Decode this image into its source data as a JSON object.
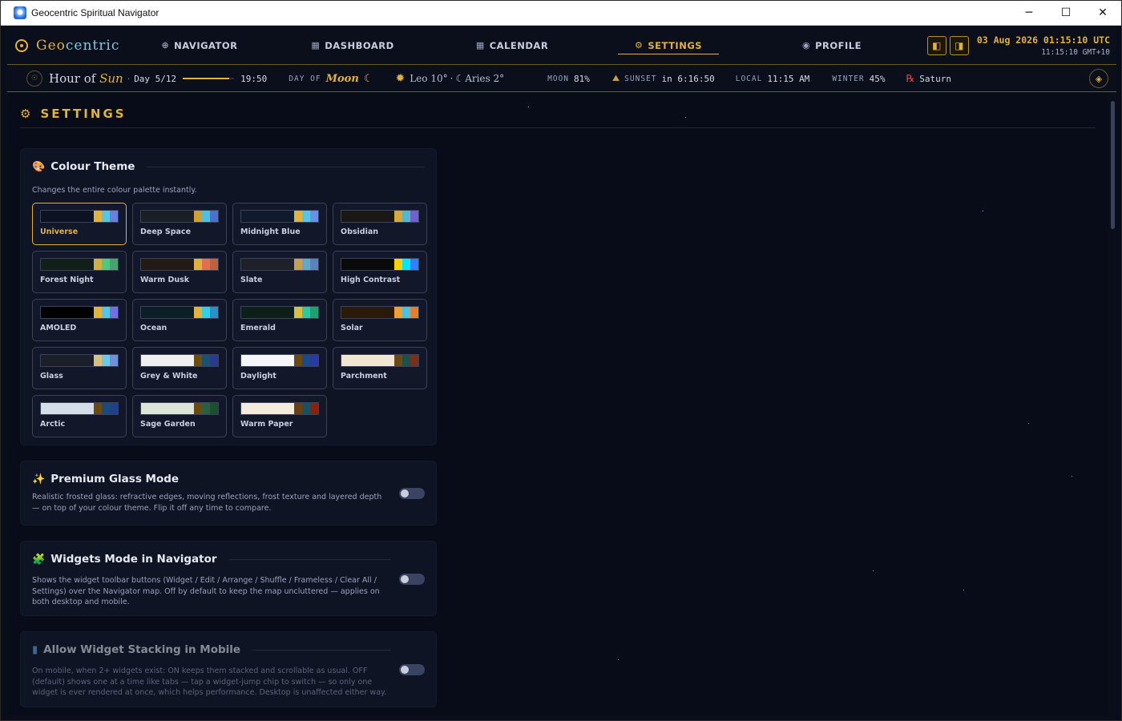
{
  "window": {
    "title": "Geocentric Spiritual Navigator",
    "minimize": "─",
    "maximize": "☐",
    "close": "✕"
  },
  "brand": {
    "prefix": "Geo",
    "suffix": "centric"
  },
  "nav": [
    {
      "icon": "globe-icon",
      "glyph": "⊕",
      "label": "NAVIGATOR"
    },
    {
      "icon": "grid-icon",
      "glyph": "▦",
      "label": "DASHBOARD"
    },
    {
      "icon": "calendar-icon",
      "glyph": "▦",
      "label": "CALENDAR"
    },
    {
      "icon": "gear-icon",
      "glyph": "⚙",
      "label": "SETTINGS",
      "active": true
    },
    {
      "icon": "profile-icon",
      "glyph": "◉",
      "label": "PROFILE"
    }
  ],
  "clock": {
    "utc": "03 Aug 2026 01:15:10 UTC",
    "local": "11:15:10 GMT+10"
  },
  "infobar": {
    "hour_of": "Hour of",
    "hour_planet": "Sun",
    "day": "Day 5/12",
    "day_progress": 0.9,
    "time": "19:50",
    "day_of_label": "DAY OF",
    "day_of_planet": "Moon",
    "sun_sign": "Leo 10°",
    "moon_sign": "Aries 2°",
    "moon_label": "MOON",
    "moon_value": "81%",
    "sunset_label": "SUNSET",
    "sunset_value": "in 6:16:50",
    "local_label": "LOCAL",
    "local_value": "11:15 AM",
    "season_label": "WINTER",
    "season_value": "45%",
    "retro_symbol": "℞",
    "retro_planet": "Saturn"
  },
  "settings": {
    "title": "SETTINGS",
    "colour_theme": {
      "heading": "Colour Theme",
      "description": "Changes the entire colour palette instantly.",
      "themes": [
        {
          "name": "Universe",
          "bg": "#0d1222",
          "colors": [
            "#e3b23c",
            "#56c6e8",
            "#6a80e0"
          ],
          "active": true
        },
        {
          "name": "Deep Space",
          "bg": "#1a1f26",
          "colors": [
            "#d0a030",
            "#50c0e0",
            "#4a70d0"
          ]
        },
        {
          "name": "Midnight Blue",
          "bg": "#101a2e",
          "colors": [
            "#e3b23c",
            "#56c6e8",
            "#6a90e8"
          ]
        },
        {
          "name": "Obsidian",
          "bg": "#1a1814",
          "colors": [
            "#d8a838",
            "#50b8d0",
            "#7060d0"
          ]
        },
        {
          "name": "Forest Night",
          "bg": "#121e18",
          "colors": [
            "#d0b040",
            "#50c880",
            "#4aa070"
          ]
        },
        {
          "name": "Warm Dusk",
          "bg": "#221a14",
          "colors": [
            "#e0b040",
            "#e07050",
            "#c06040"
          ]
        },
        {
          "name": "Slate",
          "bg": "#1e2228",
          "colors": [
            "#c8a050",
            "#60a8d0",
            "#6080b8"
          ]
        },
        {
          "name": "High Contrast",
          "bg": "#0a0a0a",
          "colors": [
            "#ffd000",
            "#00e8ff",
            "#3080ff"
          ]
        },
        {
          "name": "AMOLED",
          "bg": "#000000",
          "colors": [
            "#e3b23c",
            "#56c6e8",
            "#7070e0"
          ]
        },
        {
          "name": "Ocean",
          "bg": "#0e1e26",
          "colors": [
            "#e3b23c",
            "#30d0e8",
            "#2a90c8"
          ]
        },
        {
          "name": "Emerald",
          "bg": "#0e1e18",
          "colors": [
            "#d8c040",
            "#30c8a0",
            "#20a070"
          ]
        },
        {
          "name": "Solar",
          "bg": "#2a1a0a",
          "colors": [
            "#f0a030",
            "#50c0e0",
            "#e08030"
          ]
        },
        {
          "name": "Glass",
          "bg": "#1a1f28",
          "colors": [
            "#d8c080",
            "#70c8e8",
            "#7090d8"
          ]
        },
        {
          "name": "Grey & White",
          "bg": "#f0f0f0",
          "colors": [
            "#6a5010",
            "#1a5070",
            "#2a3a90"
          ]
        },
        {
          "name": "Daylight",
          "bg": "#f4f6fa",
          "colors": [
            "#6a4a10",
            "#1a4a8a",
            "#2a3aa0"
          ]
        },
        {
          "name": "Parchment",
          "bg": "#f0e6d2",
          "colors": [
            "#6a4a10",
            "#1a5050",
            "#7a3018"
          ]
        },
        {
          "name": "Arctic",
          "bg": "#d4dee8",
          "colors": [
            "#6a4a10",
            "#1a4a80",
            "#20408a"
          ]
        },
        {
          "name": "Sage Garden",
          "bg": "#dde4d8",
          "colors": [
            "#6a4a10",
            "#2a6040",
            "#1a5030"
          ]
        },
        {
          "name": "Warm Paper",
          "bg": "#f4ebdc",
          "colors": [
            "#6a4010",
            "#1a5060",
            "#8a2010"
          ]
        }
      ]
    },
    "premium_glass": {
      "heading": "Premium Glass Mode",
      "description": "Realistic frosted glass: refractive edges, moving reflections, frost texture and layered depth — on top of your colour theme. Flip it off any time to compare.",
      "enabled": false
    },
    "widgets_mode": {
      "heading": "Widgets Mode in Navigator",
      "description": "Shows the widget toolbar buttons (Widget / Edit / Arrange / Shuffle / Frameless / Clear All / Settings) over the Navigator map. Off by default to keep the map uncluttered — applies on both desktop and mobile.",
      "enabled": false
    },
    "widget_stacking": {
      "heading": "Allow Widget Stacking in Mobile",
      "description": "On mobile, when 2+ widgets exist: ON keeps them stacked and scrollable as usual. OFF (default) shows one at a time like tabs — tap a widget-jump chip to switch — so only one widget is ever rendered at once, which helps performance. Desktop is unaffected either way.",
      "enabled": false
    }
  },
  "colors": {
    "accent": "#e3b23c",
    "background": "#080c18",
    "card": "#0f1424"
  }
}
